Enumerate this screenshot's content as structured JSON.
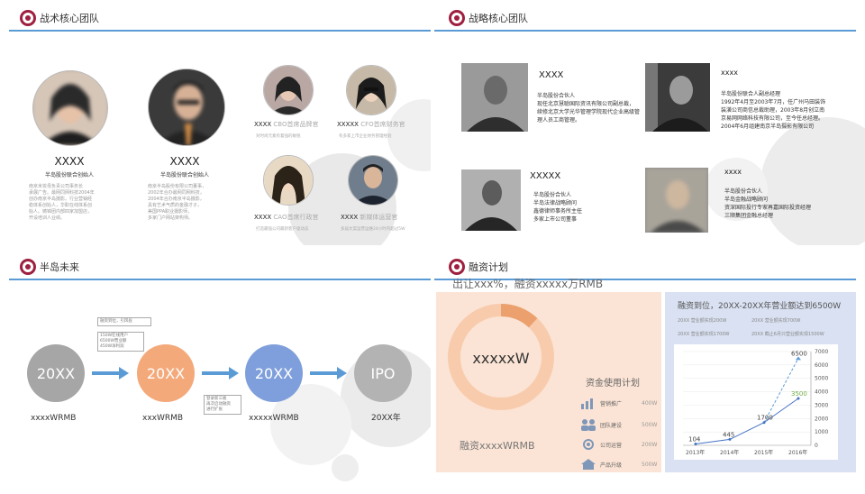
{
  "panel1": {
    "title": "战术核心团队",
    "left_members": [
      {
        "name": "XXXX",
        "role": "半岛股份联合创始人",
        "desc": "南京米妆母负责公司事务长\n承展广告。最网同网科技2004年\n创办南京半岛摄影。行业营销经\n稳体系创始人，华职在线体系创\n始人。铸锦团内部四家加盟店，\n开设培训人业绩。"
      },
      {
        "name": "XXXX",
        "role": "半岛股份联合创始人",
        "desc": "南京半岛股份有限公司董事，\n2002年合办最网同网科技，\n2004年合办南京半岛摄影，\n具有艺术气质的金融才子，\n美国PPA职业摄影师，\n多家门户网站架构师。"
      }
    ],
    "right_members": [
      {
        "name": "XXXX",
        "title": "CBO首席品牌官",
        "desc": "对时尚元素有着强的敏锐"
      },
      {
        "name": "XXXXX",
        "title": "CFO首席财务官",
        "desc": "有多家上市企业财务管理经验"
      },
      {
        "name": "XXXX",
        "title": "CAO首席行政官",
        "desc": "打造最强公司最新客户驱动态"
      },
      {
        "name": "XXXX",
        "title": "新媒体运营官",
        "desc": "多届文案运营运维24小时内超过5W"
      }
    ]
  },
  "panel2": {
    "title": "战略核心团队",
    "people": [
      {
        "name": "XXXX",
        "lines": [
          "半岛股份合伙人",
          "现任北京慧聪国际资讯有限公司副总裁，",
          "续修北京大学光华管理学院现代企业高级管",
          "理人员工商管理。"
        ]
      },
      {
        "name": "xxxx",
        "lines": [
          "半岛股份联合人副总经理",
          "1992年4月至2003年7月，任广州马田装饰",
          "装潢公司商信总裁助理，2003年8月创立南",
          "京易网网络科技有限公司，至今任总经理。",
          "2004年6月组建南京半岛摄影有限公司"
        ]
      },
      {
        "name": "XXXXX",
        "lines": [
          "半岛股份合伙人",
          "半岛法律战略顾问",
          "鑫德律师事务所主任",
          "多家上市公司董事"
        ]
      },
      {
        "name": "xxxx",
        "lines": [
          "半岛股份合伙人",
          "半岛金融战略顾问",
          "资深国际投行专家再嘉国际投资经理",
          "三顺集团金融总经理"
        ]
      }
    ]
  },
  "panel3": {
    "title": "半岛未来",
    "stages": [
      {
        "label": "20XX",
        "caption": "xxxxWRMB",
        "color": "#a6a6a6"
      },
      {
        "label": "20XX",
        "caption": "xxxWRMB",
        "color": "#f4a97b"
      },
      {
        "label": "20XX",
        "caption": "xxxxxWRMB",
        "color": "#7f9fdc"
      },
      {
        "label": "IPO",
        "caption": "20XX年",
        "color": "#b3b3b3"
      }
    ],
    "note_a": "融资到位，引风投",
    "note_b": "150W在线用户\n6500W营业额\n450W净利润",
    "note_c": "登录新三板\n再次启动融资\n进行扩张"
  },
  "panel4": {
    "title": "融资计划",
    "subtitle": "出让xxx%，融资xxxxx万RMB",
    "donut_center": "xxxxxW",
    "donut_value_fraction": 0.12,
    "financing_caption": "融资xxxxWRMB",
    "fund_title": "资金使用计划",
    "fund_items": [
      {
        "label": "营销推广",
        "amount": "400W",
        "icon": "bar-chart-icon"
      },
      {
        "label": "团队建设",
        "amount": "500W",
        "icon": "team-icon"
      },
      {
        "label": "公司运营",
        "amount": "200W",
        "icon": "gear-cycle-icon"
      },
      {
        "label": "产品升级",
        "amount": "500W",
        "icon": "house-icon"
      }
    ],
    "right_title": "融资到位，20XX-20XX年营业额达到6500W",
    "revenue_notes": [
      "20XX 营业额实现200W",
      "20XX 营业额实现700W",
      "20XX 营业额实现1700W",
      "20XX 截止6月只营业额实现1500W"
    ],
    "colors": {
      "left_bg": "#fbe4d5",
      "right_bg": "#d9e1f2",
      "donut_main": "#f8cbad",
      "donut_part": "#eba06e",
      "line_actual": "#4472c4",
      "line_forecast": "#5b9bd5",
      "last_label": "#70ad47"
    }
  },
  "chart_data": {
    "type": "line",
    "x": [
      "2013年",
      "2014年",
      "2015年",
      "2016年"
    ],
    "series": [
      {
        "values": [
          104,
          445,
          1700,
          3500
        ]
      },
      {
        "values": [
          null,
          null,
          1700,
          6500
        ]
      }
    ],
    "data_labels": [
      "104",
      "445",
      "1700",
      "3500",
      "6500"
    ],
    "yticks": [
      "0",
      "1000",
      "2000",
      "3000",
      "4000",
      "5000",
      "6000",
      "7000"
    ],
    "ylim": [
      0,
      7000
    ]
  }
}
